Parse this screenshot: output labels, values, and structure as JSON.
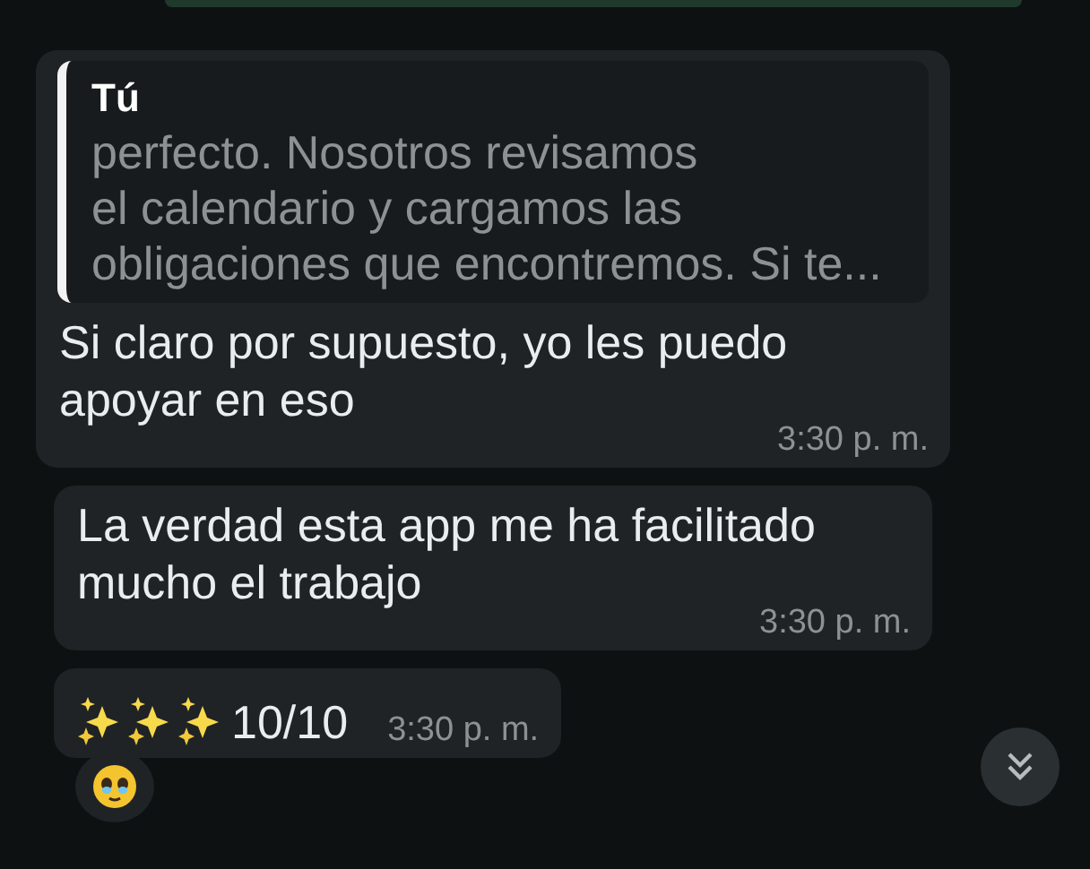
{
  "messages": [
    {
      "kind": "text",
      "quote": {
        "author": "Tú",
        "text": "perfecto. Nosotros revisamos\nel calendario y cargamos las obligaciones que encontremos. Si te..."
      },
      "text": "Si claro por supuesto, yo les puedo apoyar en eso",
      "time": "3:30 p. m.",
      "reaction": false
    },
    {
      "kind": "text",
      "text": "La verdad esta app me ha facilitado mucho el trabajo",
      "time": "3:30 p. m.",
      "reaction": false
    },
    {
      "kind": "sparkles",
      "text": "10/10",
      "time": "3:30 p. m.",
      "reaction": true
    }
  ]
}
